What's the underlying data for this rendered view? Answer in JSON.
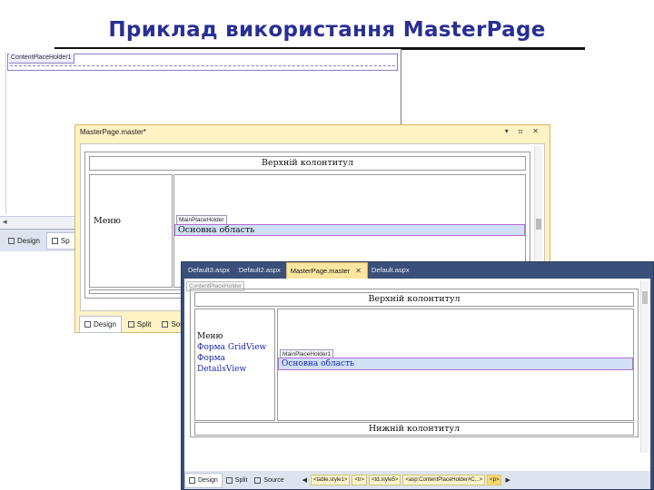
{
  "slide": {
    "title": "Приклад використання MasterPage"
  },
  "window1": {
    "placeholder_label": "ContentPlaceHolder1",
    "tabs": [
      "Design",
      "Sp"
    ]
  },
  "window2": {
    "title": "MasterPage.master*",
    "header_text": "Верхній колонтитул",
    "menu_text": "Меню",
    "main_placeholder_label": "MainPlaceHolder",
    "main_area_text": "Основна область",
    "tabs": [
      "Design",
      "Split",
      "Sou"
    ]
  },
  "window3": {
    "tabs": [
      "Default3.aspx",
      "Default2.aspx",
      "MasterPage.master",
      "Default.aspx"
    ],
    "active_tab_index": 2,
    "content_placeholder_label": "ContentPlaceHolder",
    "header_text": "Верхній колонтитул",
    "menu_items": [
      "Меню",
      "Форма GridView",
      "Форма DetailsView"
    ],
    "main_placeholder_label": "MainPlaceHolder1",
    "main_area_text": "Основна область",
    "footer_text": "Нижній колонтитул",
    "bottom_tabs": [
      "Design",
      "Split",
      "Source"
    ],
    "breadcrumbs": [
      "<table.style1>",
      "<tr>",
      "<td.style5>",
      "<asp:ContentPlaceHolder#C...>",
      "<p>"
    ]
  },
  "colors": {
    "title": "#2a2f93",
    "placeholder_border": "#b56bd4",
    "selection_fill": "#cfe0f7",
    "active_tab": "#fbe6a0",
    "window3_frame": "#3b4f7a"
  }
}
